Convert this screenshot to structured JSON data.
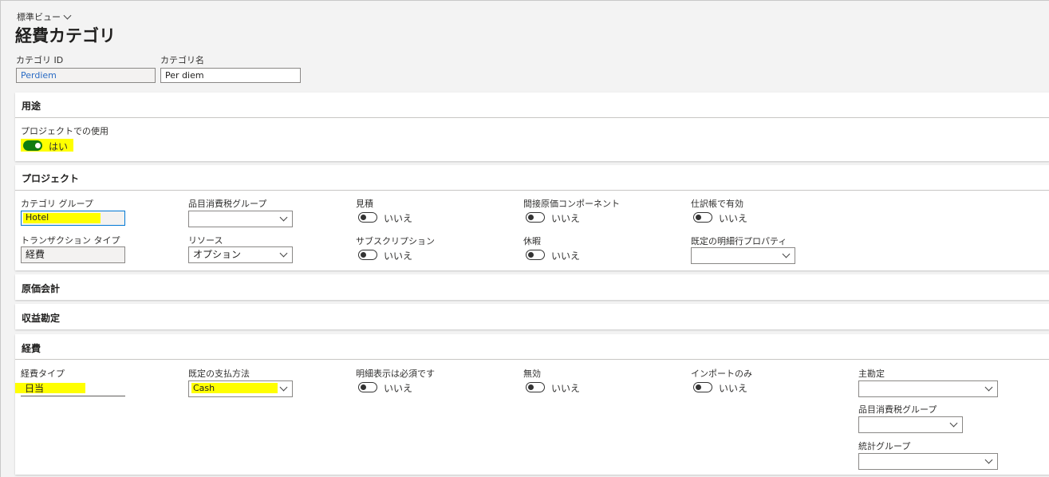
{
  "header": {
    "view_name": "標準ビュー",
    "title": "経費カテゴリ"
  },
  "top_fields": {
    "category_id_label": "カテゴリ ID",
    "category_id_value": "Perdiem",
    "category_name_label": "カテゴリ名",
    "category_name_value": "Per diem"
  },
  "sections": {
    "usage": {
      "title": "用途",
      "project_use_label": "プロジェクトでの使用",
      "project_use_value": "はい",
      "project_use_on": true
    },
    "project": {
      "title": "プロジェクト",
      "category_group_label": "カテゴリ グループ",
      "category_group_value": "Hotel",
      "transaction_type_label": "トランザクション タイプ",
      "transaction_type_value": "経費",
      "item_tax_group_label": "品目消費税グループ",
      "item_tax_group_value": "",
      "resource_label": "リソース",
      "resource_value": "オプション",
      "estimate_label": "見積",
      "estimate_value": "いいえ",
      "subscription_label": "サブスクリプション",
      "subscription_value": "いいえ",
      "indirect_cost_label": "間接原価コンポーネント",
      "indirect_cost_value": "いいえ",
      "leave_label": "休暇",
      "leave_value": "いいえ",
      "journal_enabled_label": "仕訳帳で有効",
      "journal_enabled_value": "いいえ",
      "default_line_property_label": "既定の明細行プロパティ",
      "default_line_property_value": ""
    },
    "cost_accounting": {
      "title": "原価会計"
    },
    "revenue": {
      "title": "収益勘定"
    },
    "expense": {
      "title": "経費",
      "expense_type_label": "経費タイプ",
      "expense_type_value": "日当",
      "default_payment_label": "既定の支払方法",
      "default_payment_value": "Cash",
      "receipt_required_label": "明細表示は必須です",
      "receipt_required_value": "いいえ",
      "disabled_label": "無効",
      "disabled_value": "いいえ",
      "import_only_label": "インポートのみ",
      "import_only_value": "いいえ",
      "main_account_label": "主勘定",
      "main_account_value": "",
      "item_tax_group_label": "品目消費税グループ",
      "item_tax_group_value": "",
      "statistics_group_label": "統計グループ",
      "statistics_group_value": ""
    }
  },
  "colors": {
    "highlight": "#ffff00",
    "toggle_on": "#107c10",
    "link": "#2b6cc4"
  }
}
